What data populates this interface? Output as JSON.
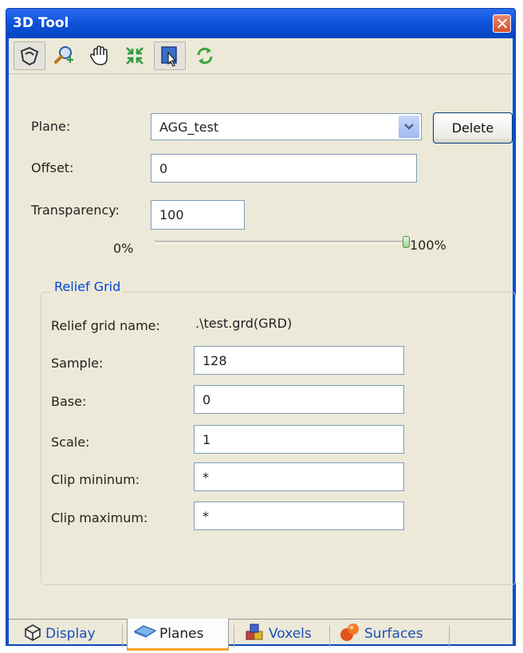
{
  "window": {
    "title": "3D Tool",
    "close_icon": "close-icon"
  },
  "toolbar": {
    "buttons": [
      {
        "icon": "rotate-icon"
      },
      {
        "icon": "zoom-icon"
      },
      {
        "icon": "pan-hand-icon"
      },
      {
        "icon": "fit-extent-icon"
      },
      {
        "icon": "select-plane-icon",
        "active": true
      },
      {
        "icon": "refresh-icon"
      }
    ]
  },
  "form": {
    "plane_label": "Plane:",
    "plane_value": "AGG_test",
    "delete_label": "Delete",
    "offset_label": "Offset:",
    "offset_value": "0",
    "transparency_label": "Transparency:",
    "transparency_value": "100",
    "slider_min_label": "0%",
    "slider_max_label": "100%",
    "slider_level": 1.0
  },
  "relief_grid": {
    "legend": "Relief Grid",
    "name_label": "Relief grid name:",
    "name_value": ".\\test.grd(GRD)",
    "sample_label": "Sample:",
    "sample_value": "128",
    "base_label": "Base:",
    "base_value": "0",
    "scale_label": "Scale:",
    "scale_value": "1",
    "clip_min_label": "Clip mininum:",
    "clip_min_value": "*",
    "clip_max_label": "Clip maximum:",
    "clip_max_value": "*"
  },
  "tabs": [
    {
      "label": "Display",
      "icon": "cube-outline-icon"
    },
    {
      "label": "Planes",
      "icon": "plane-icon",
      "selected": true
    },
    {
      "label": "Voxels",
      "icon": "voxels-icon"
    },
    {
      "label": "Surfaces",
      "icon": "surfaces-icon"
    }
  ],
  "colors": {
    "title_bar": "#0b4fd6",
    "window_bg": "#ece9d8",
    "group_legend": "#0046d5",
    "tab_highlight": "#f6a623"
  }
}
